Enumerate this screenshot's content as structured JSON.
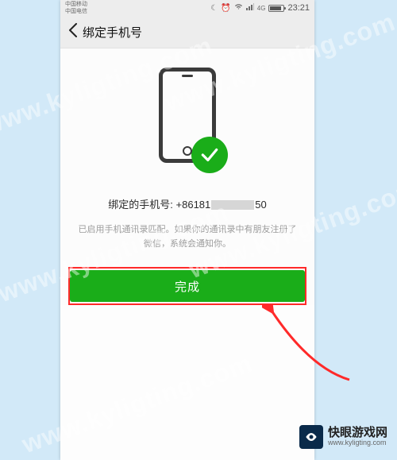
{
  "statusbar": {
    "carrier1": "中国移动",
    "carrier2": "中国电信",
    "net": "4G",
    "time": "23:21"
  },
  "navbar": {
    "title": "绑定手机号"
  },
  "bound": {
    "label": "绑定的手机号:",
    "prefix": "+86181",
    "suffix": "50"
  },
  "hint": "已启用手机通讯录匹配。如果你的通讯录中有朋友注册了微信，系统会通知你。",
  "button": {
    "done": "完成"
  },
  "watermark": "www.kyligting.com",
  "brand": {
    "name": "快眼游戏网",
    "domain": "www.kyligting.com"
  }
}
